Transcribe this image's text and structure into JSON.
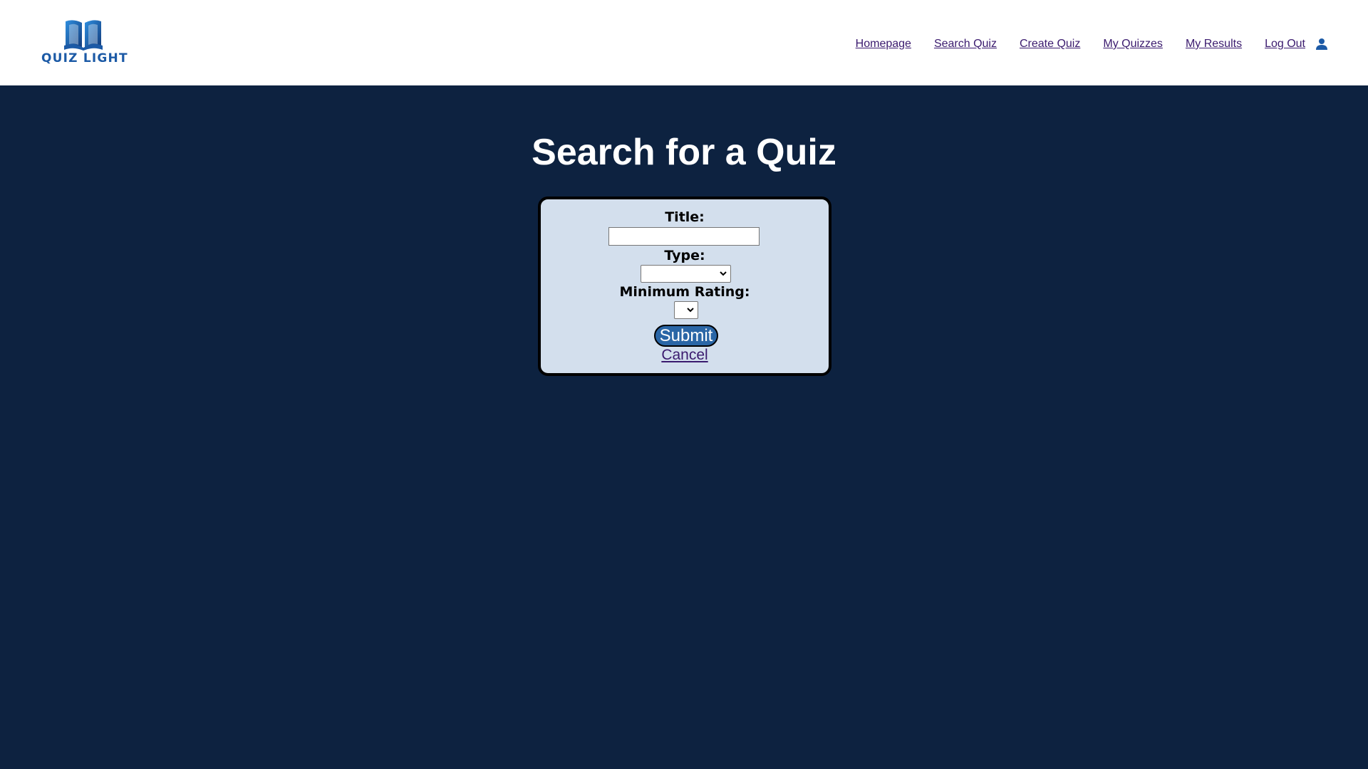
{
  "brand": {
    "name": "QUIZ LIGHT",
    "logo_icon": "open-book-icon",
    "logo_color": "#1c5aa6"
  },
  "nav": {
    "items": [
      {
        "label": "Homepage"
      },
      {
        "label": "Search Quiz"
      },
      {
        "label": "Create Quiz"
      },
      {
        "label": "My Quizzes"
      },
      {
        "label": "My Results"
      },
      {
        "label": "Log Out"
      }
    ],
    "user_icon": "user-icon",
    "link_color": "#3a1a6e"
  },
  "page": {
    "title": "Search for a Quiz",
    "background_color": "#0d2240"
  },
  "form": {
    "background_color": "#d3dfed",
    "title_label": "Title:",
    "title_value": "",
    "title_placeholder": "",
    "type_label": "Type:",
    "type_selected": "",
    "rating_label": "Minimum Rating:",
    "rating_selected": "",
    "submit_label": "Submit",
    "submit_color": "#2a66a6",
    "cancel_label": "Cancel"
  }
}
